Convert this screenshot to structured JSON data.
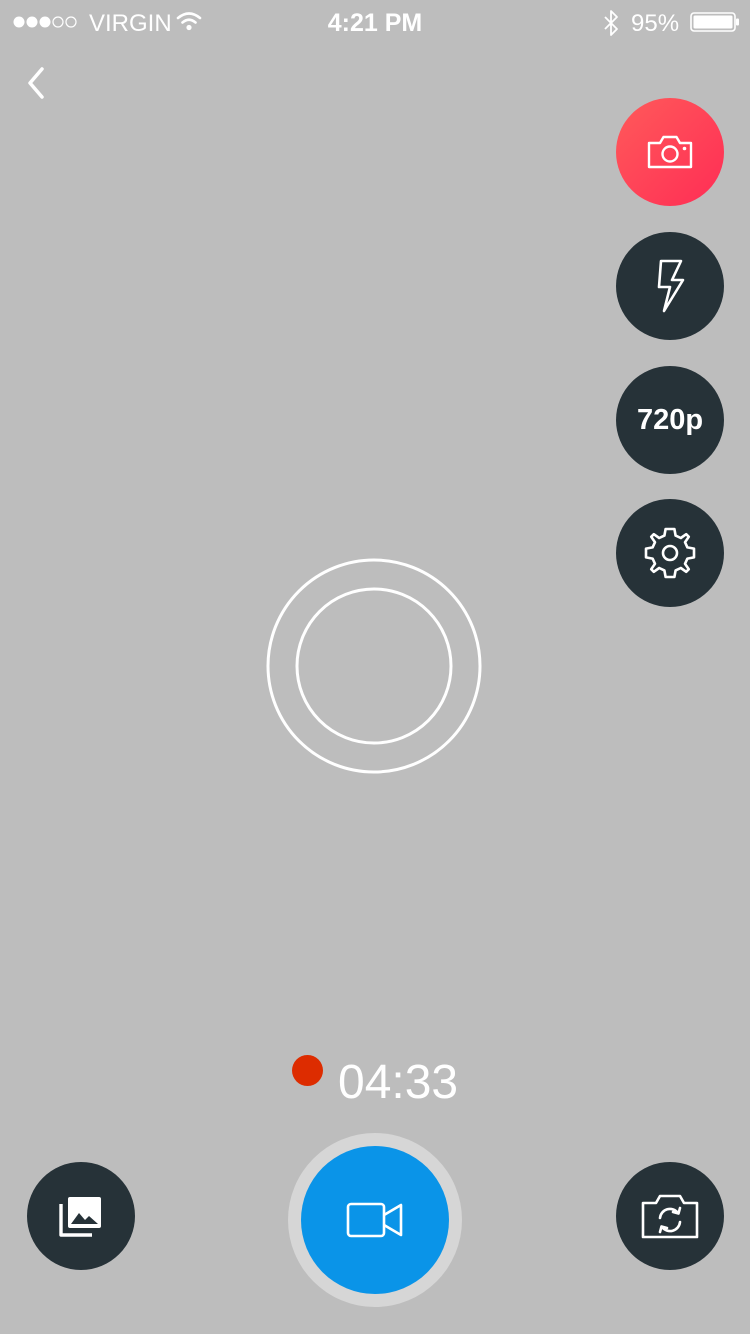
{
  "status_bar": {
    "carrier": "VIRGIN",
    "time": "4:21 PM",
    "battery_percent": "95%",
    "signal_bars_filled": 3,
    "signal_bars_total": 5
  },
  "controls": {
    "resolution_label": "720p"
  },
  "recording": {
    "elapsed": "04:33",
    "indicator_color": "#dd2c00"
  },
  "colors": {
    "background": "#bdbdbd",
    "accent_red": "#ff2d55",
    "accent_blue": "#0a94e8",
    "button_dark": "#263238"
  },
  "icons": {
    "back": "chevron-left-icon",
    "camera": "camera-icon",
    "flash": "flash-icon",
    "settings": "gear-icon",
    "gallery": "gallery-icon",
    "record": "video-camera-icon",
    "flip": "camera-switch-icon"
  }
}
